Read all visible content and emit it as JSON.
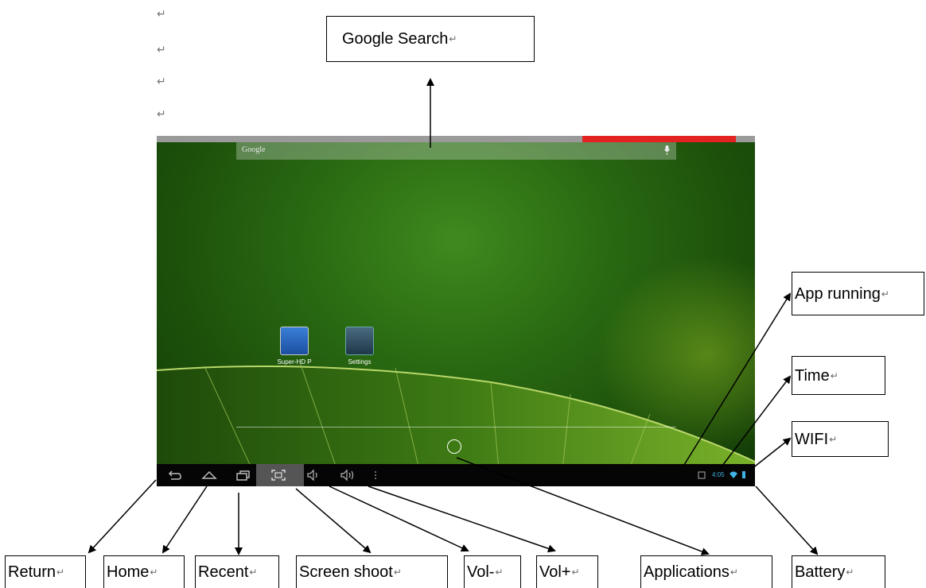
{
  "callouts": {
    "google_search": "Google Search",
    "app_running": "App running",
    "time": "Time",
    "wifi": "WIFI",
    "return": "Return",
    "home": "Home",
    "recent": "Recent",
    "screen_shoot": "Screen shoot",
    "vol_minus": "Vol-",
    "vol_plus": "Vol+",
    "applications": "Applications",
    "battery": "Battery"
  },
  "paragraph_mark": "↵",
  "screen": {
    "search_label": "Google",
    "apps": [
      {
        "name": "Super-HD P",
        "icon": "video-player-icon"
      },
      {
        "name": "Settings",
        "icon": "settings-icon"
      }
    ],
    "time": "4:05"
  },
  "colors": {
    "wallpaper": "#2a6a12",
    "navbar": "#050505",
    "status_red": "#e32222",
    "time_text": "#3fb3e6"
  }
}
